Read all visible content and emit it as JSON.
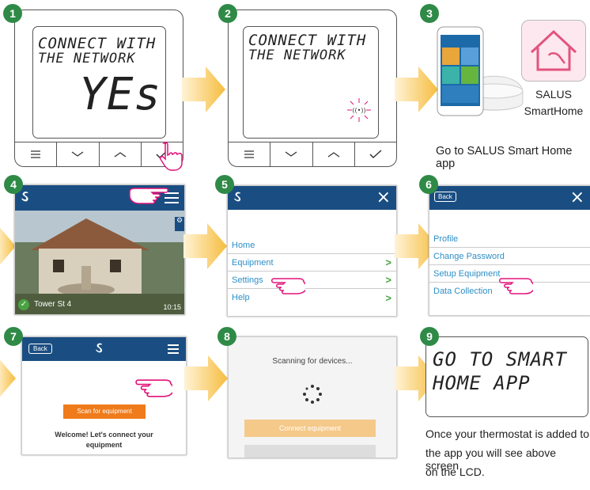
{
  "steps": [
    "1",
    "2",
    "3",
    "4",
    "5",
    "6",
    "7",
    "8",
    "9"
  ],
  "step1": {
    "lcd_line1": "CONNECT WITH",
    "lcd_line2": "THE NETWORK",
    "lcd_value": "YEs"
  },
  "step2": {
    "lcd_line1": "CONNECT WITH",
    "lcd_line2": "THE NETWORK"
  },
  "step3": {
    "app_name_line1": "SALUS",
    "app_name_line2": "SmartHome",
    "caption": "Go to SALUS Smart Home app"
  },
  "step4": {
    "location": "Tower St 4",
    "time": "10:15"
  },
  "step5": {
    "menu": [
      "Home",
      "Equipment",
      "Settings",
      "Help"
    ],
    "close": "×"
  },
  "step6": {
    "back": "Back",
    "menu": [
      "Profile",
      "Change Password",
      "Setup Equipment",
      "Data Collection"
    ],
    "close": "×"
  },
  "step7": {
    "back": "Back",
    "scan_button": "Scan for equipment",
    "welcome_line1": "Welcome! Let's connect your",
    "welcome_line2": "equipment"
  },
  "step8": {
    "scanning": "Scanning for devices...",
    "connect_button": "Connect equipment"
  },
  "step9": {
    "lcd_line1": "GO TO SMART",
    "lcd_line2": "HOME APP",
    "caption_line1": "Once your thermostat is added to",
    "caption_line2": "the app you will see above screen",
    "caption_line3": "on the LCD."
  },
  "colors": {
    "badge": "#2f8a47",
    "arrow": "#f6c24a",
    "app_bar": "#1a4e82",
    "link": "#2d8fc7",
    "scan_button": "#f07b1a"
  }
}
